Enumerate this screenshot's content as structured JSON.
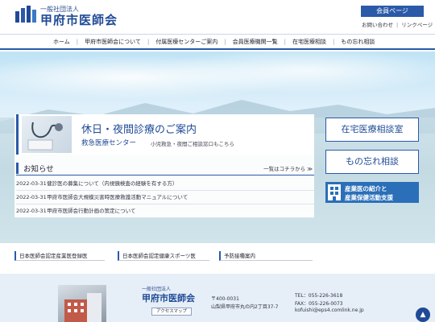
{
  "header": {
    "logo_sub": "一般社団法人",
    "logo_main": "甲府市医師会",
    "member_page": "会員ページ",
    "contact": "お問い合わせ",
    "link_page": "リンクページ"
  },
  "nav": {
    "items": [
      "ホーム",
      "甲府市医師会について",
      "付属医療センターご案内",
      "会員医療機関一覧",
      "在宅医療相談",
      "もの忘れ相談"
    ],
    "separator": "|"
  },
  "feature": {
    "title": "休日・夜間診療のご案内",
    "subtitle": "救急医療センター",
    "note": "小児救急・夜間ご相談窓口もこちら"
  },
  "news": {
    "title": "お知らせ",
    "more": "一覧はコチラから ≫",
    "items": [
      {
        "date": "2022-03-31",
        "text": "健診医の募集について（内視鏡検査の経験を有する方）"
      },
      {
        "date": "2022-03-31",
        "text": "甲府市医師会大規模災害時医療救護活動マニュアルについて"
      },
      {
        "date": "2022-03-31",
        "text": "甲府市医師会行動計画の策定について"
      }
    ]
  },
  "side": {
    "btn1": "在宅医療相談室",
    "btn2": "もの忘れ相談",
    "blue_line1": "産業医の紹介と",
    "blue_line2": "産業保健活動支援"
  },
  "links": [
    "日本医師会認定産業医登録医",
    "日本医師会認定健康スポーツ医",
    "予防接種案内"
  ],
  "footer": {
    "sub": "一般社団法人",
    "main": "甲府市医師会",
    "access": "アクセスマップ",
    "zip": "〒400-0031",
    "address": "山梨県甲府市丸の内2丁目37-7",
    "tel": "TEL：055-226-3618",
    "fax": "FAX：055-226-0073",
    "mail": "kofuishi@eps4.comlink.ne.jp",
    "totop": "▲"
  },
  "colors": {
    "accent": "#2a5aa8",
    "title": "#1f4a96",
    "footer_bg": "#e6eef7"
  }
}
